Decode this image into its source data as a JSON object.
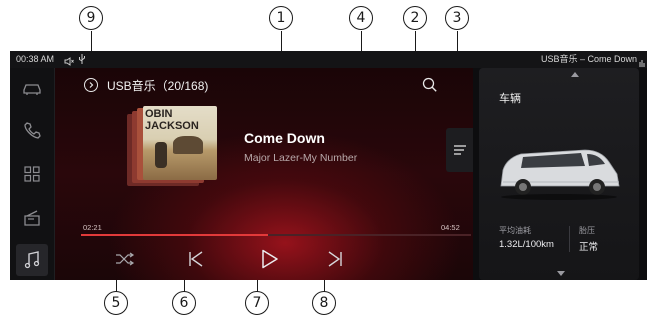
{
  "callouts": [
    "1",
    "2",
    "3",
    "4",
    "5",
    "6",
    "7",
    "8",
    "9"
  ],
  "status": {
    "time": "00:38 AM",
    "now_playing": "USB音乐 – Come Down"
  },
  "player": {
    "source_title": "USB音乐（20/168)",
    "song_title": "Come Down",
    "song_subtitle": "Major Lazer-My Number",
    "album_art_text_top": "OBIN",
    "album_art_text_mid": "JACKSON",
    "elapsed": "02:21",
    "duration": "04:52",
    "progress_fraction": 0.48
  },
  "side_nav": [
    {
      "name": "car-icon"
    },
    {
      "name": "phone-icon"
    },
    {
      "name": "apps-grid-icon"
    },
    {
      "name": "radio-icon"
    },
    {
      "name": "music-note-icon"
    }
  ],
  "vehicle": {
    "title": "车辆",
    "fuel_label": "平均油耗",
    "fuel_value": "1.32L/100km",
    "tire_label": "胎压",
    "tire_value": "正常"
  },
  "colors": {
    "accent": "#d01a24",
    "progress_fill": "#e23a3a"
  }
}
